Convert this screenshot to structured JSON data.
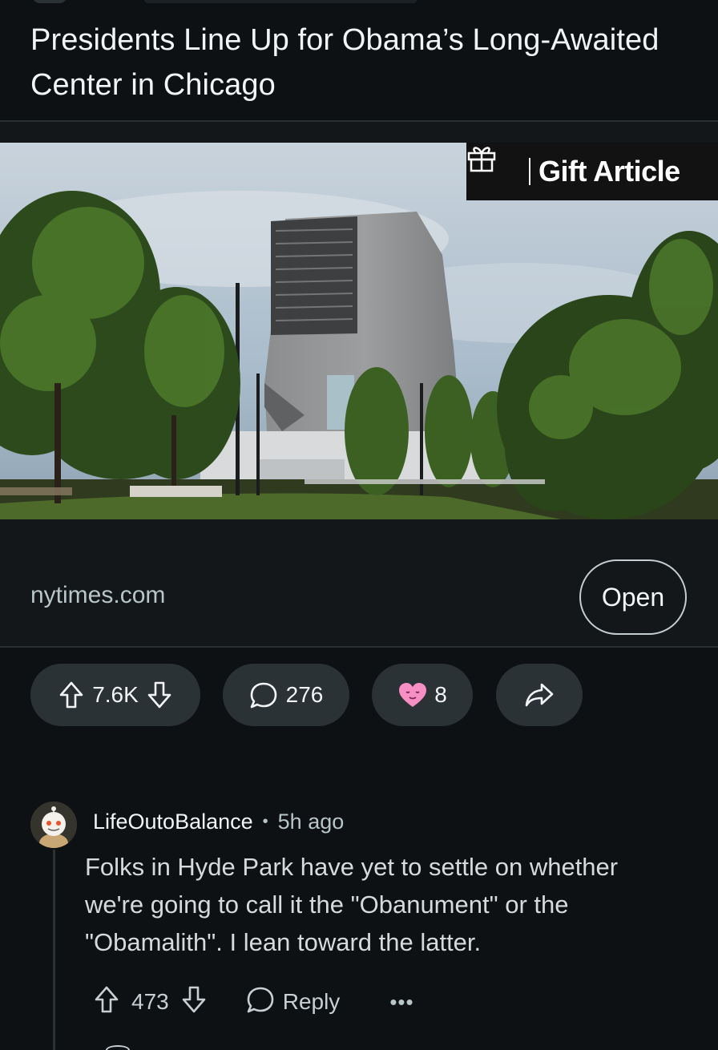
{
  "post": {
    "title": "Presidents Line Up for Obama’s Long-Awaited Center in Chicago"
  },
  "link_card": {
    "badge_label": "Gift Article",
    "badge_icon": "gift-icon",
    "domain": "nytimes.com",
    "open_label": "Open"
  },
  "actions": {
    "upvote_icon": "upvote-arrow-icon",
    "vote_count": "7.6K",
    "downvote_icon": "downvote-arrow-icon",
    "comment_icon": "comment-bubble-icon",
    "comment_count": "276",
    "award_icon": "award-heart-icon",
    "award_count": "8",
    "share_icon": "share-arrow-icon"
  },
  "comment": {
    "author": "LifeOutoBalance",
    "separator": "•",
    "time": "5h ago",
    "text": "Folks in Hyde Park have yet to settle on whether we're going to call it the \"Obanument\" or the \"Obamalith\". I lean toward the latter.",
    "vote_count": "473",
    "reply_label": "Reply",
    "more_label": "•••"
  },
  "colors": {
    "background": "#0e1113",
    "pill": "#2a3236",
    "text": "#f2f4f5",
    "muted": "#b8c5c9",
    "award_pink": "#f58fc4"
  }
}
